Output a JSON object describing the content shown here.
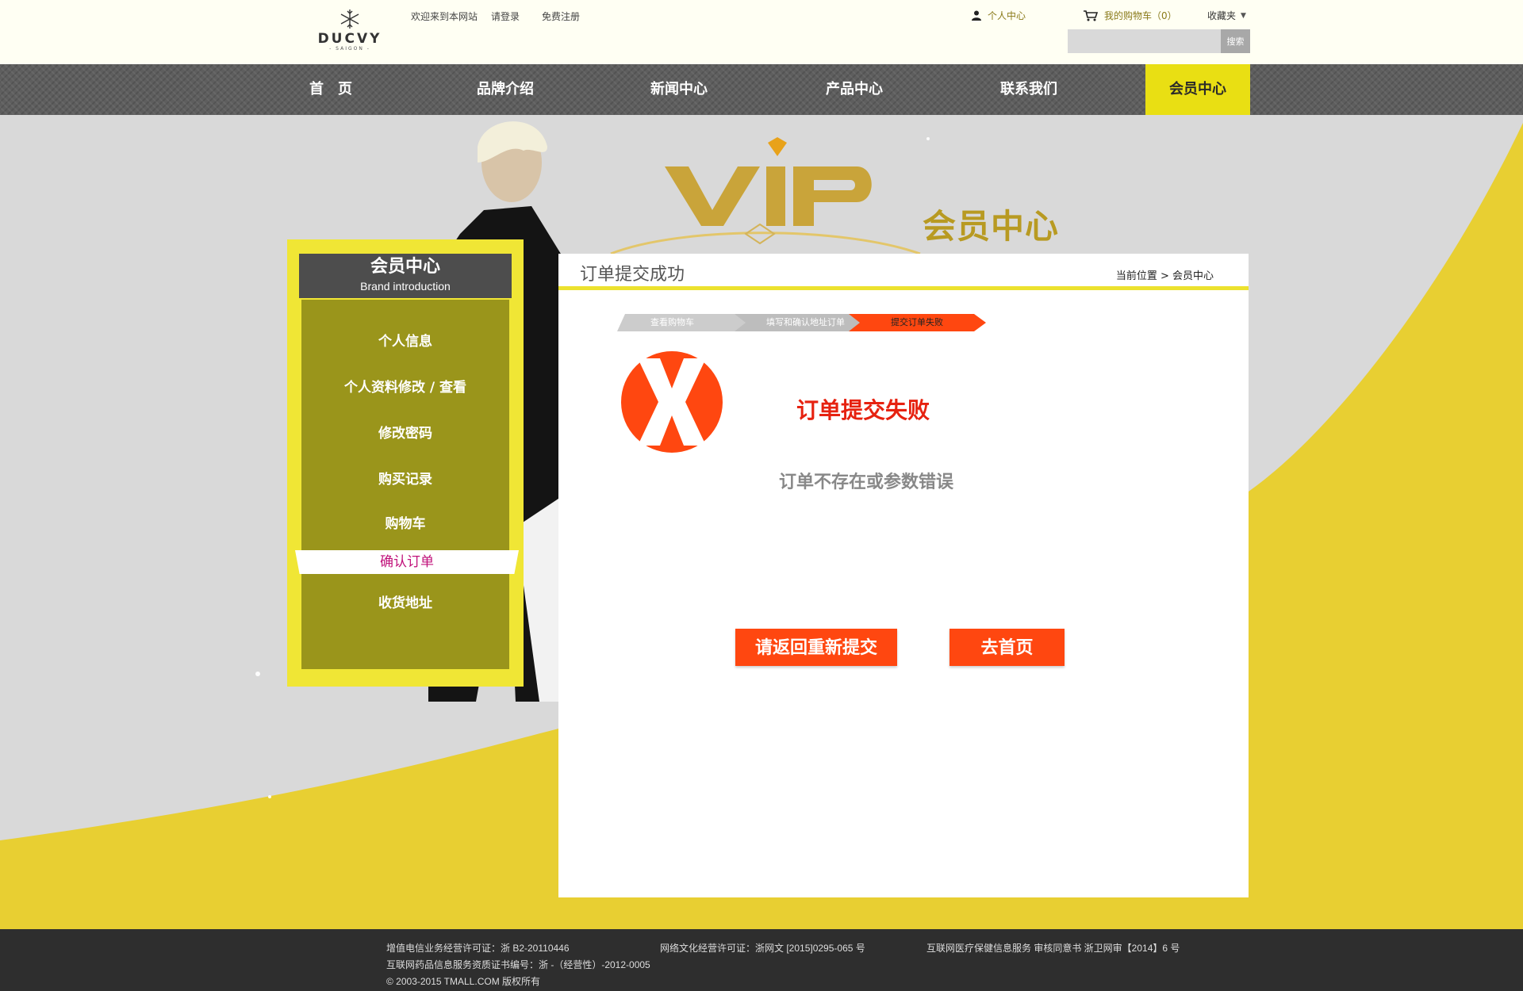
{
  "brand": {
    "name": "DUCVY",
    "sub": "- SAIGON -"
  },
  "toplinks": [
    "欢迎来到本网站",
    "请登录",
    "免费注册"
  ],
  "user_center_label": "个人中心",
  "cart_label": "我的购物车（0）",
  "favorites_label": "收藏夹",
  "search": {
    "placeholder": "",
    "button": "搜索"
  },
  "nav": [
    "首　页",
    "品牌介绍",
    "新闻中心",
    "产品中心",
    "联系我们",
    "会员中心"
  ],
  "banner": {
    "title": "会员中心"
  },
  "sidebar": {
    "title": "会员中心",
    "subtitle": "Brand introduction",
    "items": [
      "个人信息",
      "个人资料修改 / 查看",
      "修改密码",
      "购买记录",
      "购物车",
      "确认订单",
      "收货地址"
    ],
    "active_index": 5
  },
  "main": {
    "title": "订单提交成功",
    "breadcrumb": "当前位置 > 会员中心",
    "steps": [
      "查看购物车",
      "填写和确认地址订单",
      "提交订单失败"
    ],
    "fail_title": "订单提交失败",
    "fail_reason": "订单不存在或参数错误",
    "buttons": {
      "resubmit": "请返回重新提交",
      "home": "去首页"
    }
  },
  "footer": {
    "license1": "增值电信业务经营许可证：浙 B2-20110446",
    "license2": "网络文化经营许可证：浙网文 [2015]0295-065 号",
    "license3": "互联网医疗保健信息服务 审核同意书 浙卫网审【2014】6 号",
    "license4": "互联网药品信息服务资质证书编号：浙 -（经营性）-2012-0005",
    "copyright": "© 2003-2015 TMALL.COM 版权所有"
  },
  "colors": {
    "accent_yellow": "#e9df13",
    "alert_red": "#ff4710",
    "nav_gray": "#5e5e5e",
    "footer": "#2e2e2e"
  }
}
